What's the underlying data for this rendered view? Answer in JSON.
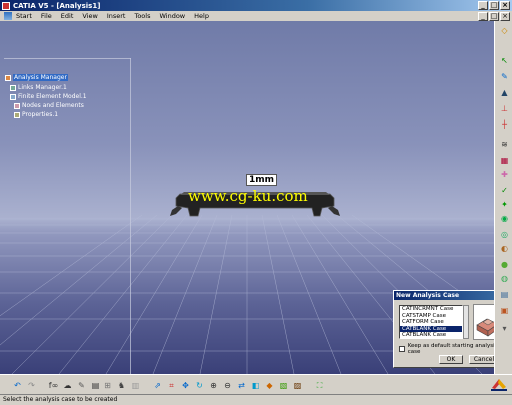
{
  "window": {
    "title": "CATIA V5 - [Analysis1]"
  },
  "menu": {
    "items": [
      "Start",
      "File",
      "Edit",
      "View",
      "Insert",
      "Tools",
      "Window",
      "Help"
    ]
  },
  "tree": {
    "nodes": [
      {
        "label": "Analysis Manager",
        "icon": "analysis-manager-icon"
      },
      {
        "label": "Links Manager.1",
        "icon": "links-manager-icon"
      },
      {
        "label": "Finite Element Model.1",
        "icon": "fem-icon"
      },
      {
        "label": "Nodes and Elements",
        "icon": "mesh-icon"
      },
      {
        "label": "Properties.1",
        "icon": "properties-icon"
      }
    ]
  },
  "viewport": {
    "dimension_label": "1mm",
    "watermark": "www.cg-ku.com"
  },
  "dialog": {
    "title": "New Analysis Case",
    "close": "×",
    "options": [
      "CATINCRMNT Case",
      "CATSTAMP Case",
      "CATFORM Case",
      "CATBLANK Case",
      "CATBLANK Case"
    ],
    "selected_index": 3,
    "checkbox_label": "Keep as default starting analysis case",
    "ok_label": "OK",
    "cancel_label": "Cancel"
  },
  "status": {
    "text": "Select the analysis case to be created"
  },
  "window_buttons": {
    "minimize": "_",
    "maximize": "□",
    "close": "×"
  },
  "colors": {
    "selection": "#0a246a",
    "watermark": "#ffff00",
    "title_gradient_start": "#0a246a"
  }
}
